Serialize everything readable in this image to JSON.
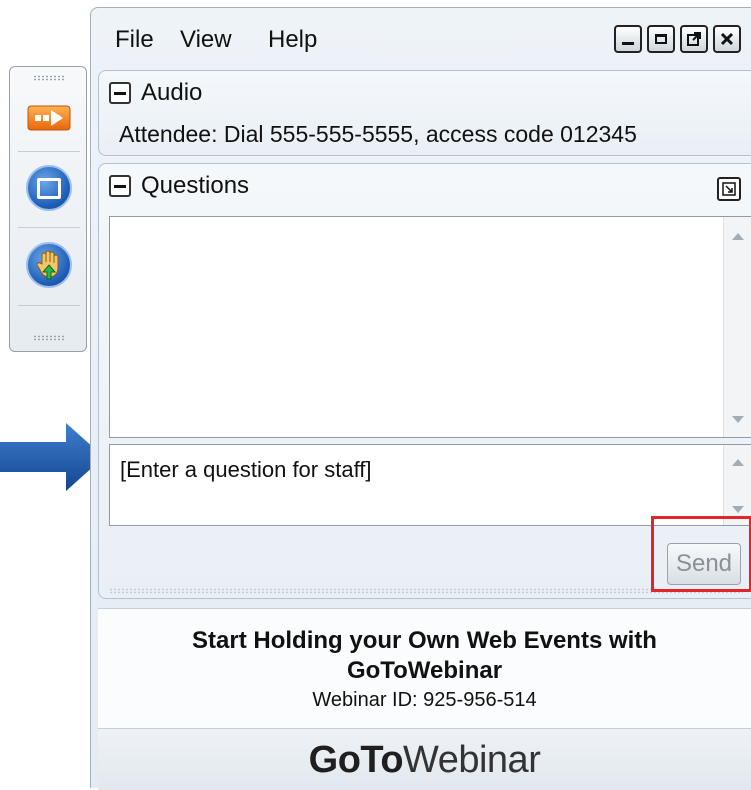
{
  "menu": {
    "file": "File",
    "view": "View",
    "help": "Help"
  },
  "window_controls": [
    "minimize-icon",
    "restore-icon",
    "popout-icon",
    "close-icon"
  ],
  "audio": {
    "title": "Audio",
    "info": "Attendee: Dial 555-555-5555, access code 012345"
  },
  "questions": {
    "title": "Questions",
    "input_value": "[Enter a question for staff]",
    "send_label": "Send"
  },
  "promo": {
    "line1": "Start Holding your Own Web Events with",
    "line2": "GoToWebinar",
    "webinar_id": "Webinar ID: 925-956-514"
  },
  "logo": {
    "part1": "GoTo",
    "part2": "Webinar"
  },
  "toolbar": {
    "icons": [
      "arrow-orange-icon",
      "stop-screen-icon",
      "raise-hand-icon"
    ]
  },
  "colors": {
    "accent_blue": "#1f5fb8",
    "arrow_blue": "#1e5aa6",
    "highlight_red": "#e0262a",
    "orange": "#f07d1e"
  }
}
